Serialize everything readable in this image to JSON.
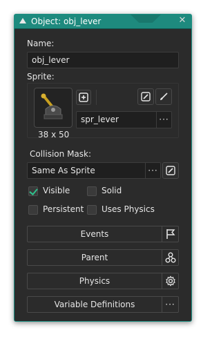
{
  "window": {
    "title": "Object: obj_lever",
    "close_glyph": "✕"
  },
  "name": {
    "label": "Name:",
    "value": "obj_lever"
  },
  "sprite": {
    "label": "Sprite:",
    "value": "spr_lever",
    "size_text": "38 x 50",
    "browse_glyph": "···"
  },
  "collision": {
    "label": "Collision Mask:",
    "value": "Same As Sprite",
    "browse_glyph": "···"
  },
  "checkboxes": {
    "visible": {
      "label": "Visible",
      "checked": true
    },
    "solid": {
      "label": "Solid",
      "checked": false
    },
    "persistent": {
      "label": "Persistent",
      "checked": false
    },
    "uses_physics": {
      "label": "Uses Physics",
      "checked": false
    }
  },
  "buttons": {
    "events": "Events",
    "parent": "Parent",
    "physics": "Physics",
    "variable_definitions": "Variable Definitions",
    "variable_side_glyph": "···"
  },
  "colors": {
    "accent": "#1e8a7e",
    "panel": "#2b2b2b",
    "field": "#1f1f1f",
    "check": "#2fc18c"
  },
  "icons": {
    "collapse": "triangle-up-icon",
    "close": "close-icon",
    "new_sprite": "new-sprite-icon",
    "edit_sprite": "edit-image-icon",
    "edit_brush": "brush-icon",
    "edit_mask": "edit-image-icon",
    "events": "flag-icon",
    "parent": "hierarchy-icon",
    "physics": "gear-icon"
  }
}
